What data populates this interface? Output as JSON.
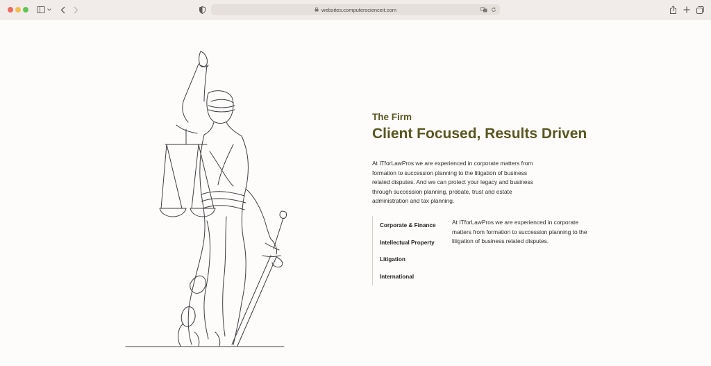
{
  "browser": {
    "url": "websites.computerscienceit.com"
  },
  "firm": {
    "eyebrow": "The Firm",
    "headline": "Client Focused, Results Driven",
    "intro": "At ITforLawPros we are experienced in corporate matters from formation to succession planning to the litigation of business related disputes. And we can protect your legacy and business through succession planning, probate, trust and estate administration and tax planning."
  },
  "practice_areas": {
    "items": [
      {
        "label": "Corporate & Finance"
      },
      {
        "label": "Intellectual Property"
      },
      {
        "label": "Litigation"
      },
      {
        "label": "International"
      }
    ],
    "description": "At ITforLawPros we are experienced in corporate matters from formation to succession planning to the litigation of business related disputes."
  },
  "colors": {
    "accent": "#59561f",
    "text": "#2b2b2b",
    "background": "#fdfcfb"
  }
}
